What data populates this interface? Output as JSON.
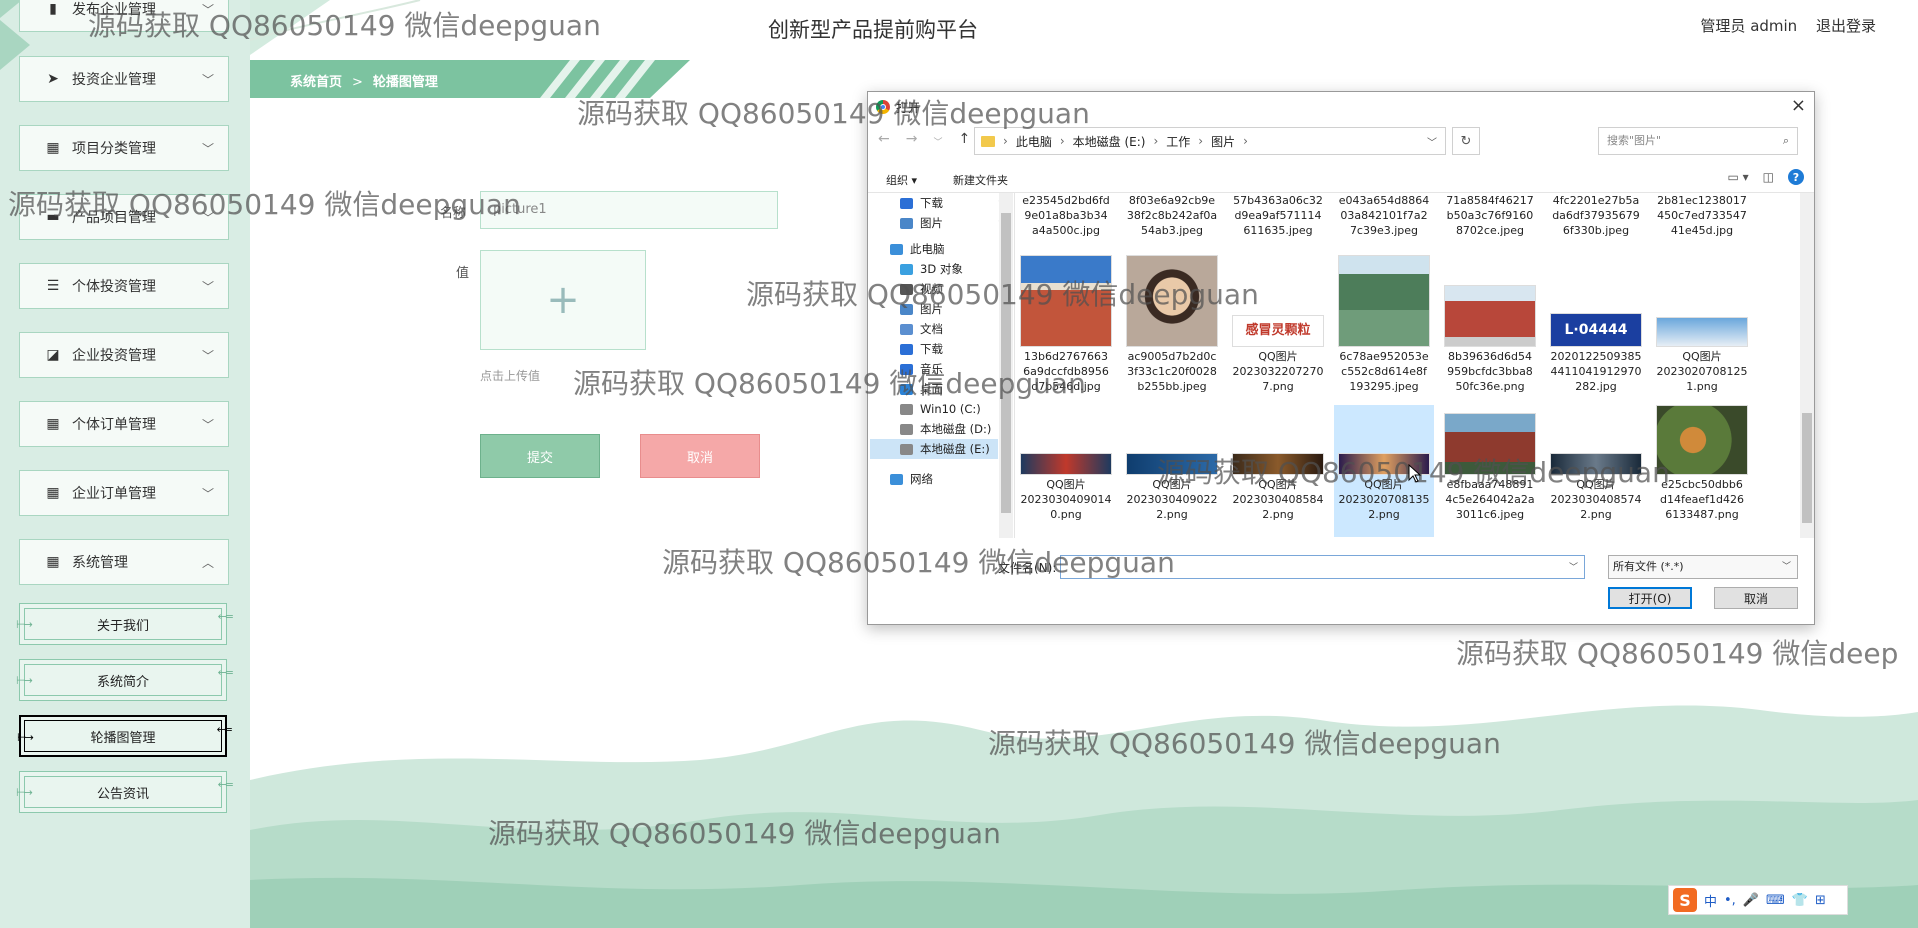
{
  "app": {
    "site_title": "创新型产品提前购平台",
    "user_label": "管理员 admin",
    "logout": "退出登录"
  },
  "breadcrumb": {
    "home": "系统首页",
    "sep": ">",
    "current": "轮播图管理"
  },
  "sidebar": {
    "items": [
      {
        "label": "发布企业管理",
        "icon": "brush-icon"
      },
      {
        "label": "投资企业管理",
        "icon": "send-icon"
      },
      {
        "label": "项目分类管理",
        "icon": "grid-icon"
      },
      {
        "label": "产品项目管理",
        "icon": "card-icon"
      },
      {
        "label": "个体投资管理",
        "icon": "list-icon"
      },
      {
        "label": "企业投资管理",
        "icon": "chart-icon"
      },
      {
        "label": "个体订单管理",
        "icon": "grid-icon"
      },
      {
        "label": "企业订单管理",
        "icon": "grid-icon"
      },
      {
        "label": "系统管理",
        "icon": "grid-icon"
      }
    ],
    "subitems": [
      "关于我们",
      "系统简介",
      "轮播图管理",
      "公告资讯"
    ],
    "active_subitem": "轮播图管理"
  },
  "form": {
    "name_label": "名称",
    "name_value": "picture1",
    "value_label": "值",
    "upload_plus": "+",
    "upload_hint": "点击上传值",
    "submit": "提交",
    "cancel": "取消"
  },
  "dialog": {
    "title": "打开",
    "close": "×",
    "address": {
      "crumbs": [
        "此电脑",
        "本地磁盘 (E:)",
        "工作",
        "图片"
      ]
    },
    "search_placeholder": "搜索\"图片\"",
    "toolbar": {
      "organize": "组织 ▾",
      "new_folder": "新建文件夹"
    },
    "nav_items": [
      {
        "label": "下载",
        "pin": true,
        "color": "#2b6fd6"
      },
      {
        "label": "图片",
        "pin": true,
        "color": "#4a86c8"
      },
      {
        "label": "此电脑",
        "color": "#3b8fd9"
      },
      {
        "label": "3D 对象",
        "color": "#3aa0e0"
      },
      {
        "label": "视频",
        "color": "#555"
      },
      {
        "label": "图片",
        "color": "#4a86c8"
      },
      {
        "label": "文档",
        "color": "#5b8fd0"
      },
      {
        "label": "下载",
        "color": "#2b6fd6"
      },
      {
        "label": "音乐",
        "color": "#2b6fd6"
      },
      {
        "label": "桌面",
        "color": "#2b82d6"
      },
      {
        "label": "Win10 (C:)",
        "color": "#888"
      },
      {
        "label": "本地磁盘 (D:)",
        "color": "#888"
      },
      {
        "label": "本地磁盘 (E:)",
        "color": "#888",
        "selected": true
      },
      {
        "label": "网络",
        "color": "#3b8fd9"
      }
    ],
    "files_row1": [
      [
        "e23545d2bd6fd",
        "9e01a8ba3b34",
        "a4a500c.jpg"
      ],
      [
        "8f03e6a92cb9e",
        "38f2c8b242af0a",
        "54ab3.jpeg"
      ],
      [
        "57b4363a06c32",
        "d9ea9af571114",
        "611635.jpeg"
      ],
      [
        "e043a654d8864",
        "03a842101f7a2",
        "7c39e3.jpeg"
      ],
      [
        "71a8584f46217",
        "b50a3c76f9160",
        "8702ce.jpeg"
      ],
      [
        "4fc2201e27b5a",
        "da6df37935679",
        "6f330b.jpeg"
      ],
      [
        "2b81ec1238017",
        "450c7ed733547",
        "41e45d.jpg"
      ]
    ],
    "files_row2": [
      [
        "13b6d2767663",
        "6a9dccfdb8956",
        "d7b546d.jpg"
      ],
      [
        "ac9005d7b2d0c",
        "3f33c1c20f0028",
        "b255bb.jpeg"
      ],
      [
        "QQ图片",
        "2023032207270",
        "7.png"
      ],
      [
        "6c78ae952053e",
        "c552c8d614e8f",
        "193295.jpeg"
      ],
      [
        "8b39636d6d54",
        "959bcfdc3bba8",
        "50fc36e.png"
      ],
      [
        "2020122509385",
        "4411041912970",
        "282.jpg"
      ],
      [
        "QQ图片",
        "2023020708125",
        "1.png"
      ]
    ],
    "files_row3": [
      [
        "QQ图片",
        "2023030409014",
        "0.png"
      ],
      [
        "QQ图片",
        "2023030409022",
        "2.png"
      ],
      [
        "QQ图片",
        "2023030408584",
        "2.png"
      ],
      [
        "QQ图片",
        "2023020708135",
        "2.png"
      ],
      [
        "e8fbaaa748891",
        "4c5e264042a2a",
        "3011c6.jpeg"
      ],
      [
        "QQ图片",
        "2023030408574",
        "2.png"
      ],
      [
        "e25cbc50dbb6",
        "d14feaef1d426",
        "6133487.png"
      ]
    ],
    "thumb_text": {
      "ganmao": "感冒灵颗粒",
      "plate": "L·04444"
    },
    "filename_label": "文件名(N):",
    "filename_value": "",
    "filetype": "所有文件 (*.*)",
    "open": "打开(O)",
    "cancel": "取消"
  },
  "ime": {
    "lang": "中",
    "items": [
      "•,",
      "🎤",
      "⌨",
      "👕",
      "⊞"
    ]
  },
  "watermark": "源码获取 QQ86050149 微信deepguan",
  "watermark_cut": "源码获取 QQ86050149 微信deep",
  "colors": {
    "accent": "#7cc3a0",
    "sidebar_bg": "#d9ede4",
    "submit": "#8fcaa9",
    "cancel": "#f5a8a8"
  }
}
